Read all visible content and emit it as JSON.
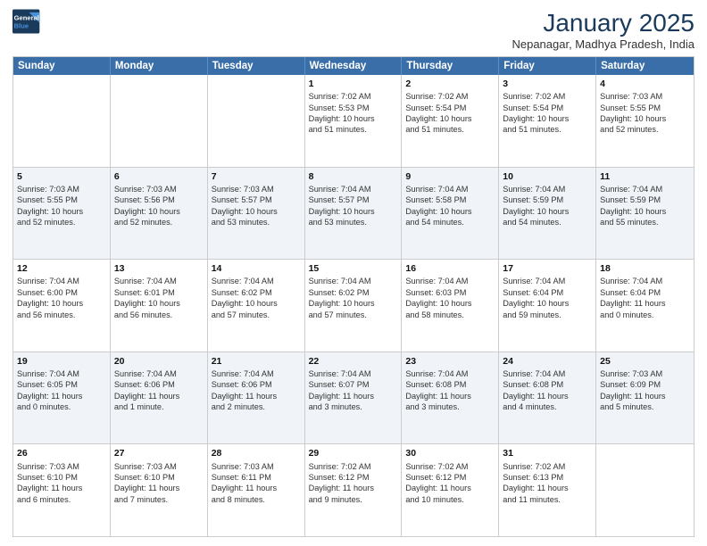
{
  "header": {
    "logo_line1": "General",
    "logo_line2": "Blue",
    "month": "January 2025",
    "location": "Nepanagar, Madhya Pradesh, India"
  },
  "days_of_week": [
    "Sunday",
    "Monday",
    "Tuesday",
    "Wednesday",
    "Thursday",
    "Friday",
    "Saturday"
  ],
  "rows": [
    [
      {
        "day": "",
        "info": ""
      },
      {
        "day": "",
        "info": ""
      },
      {
        "day": "",
        "info": ""
      },
      {
        "day": "1",
        "info": "Sunrise: 7:02 AM\nSunset: 5:53 PM\nDaylight: 10 hours\nand 51 minutes."
      },
      {
        "day": "2",
        "info": "Sunrise: 7:02 AM\nSunset: 5:54 PM\nDaylight: 10 hours\nand 51 minutes."
      },
      {
        "day": "3",
        "info": "Sunrise: 7:02 AM\nSunset: 5:54 PM\nDaylight: 10 hours\nand 51 minutes."
      },
      {
        "day": "4",
        "info": "Sunrise: 7:03 AM\nSunset: 5:55 PM\nDaylight: 10 hours\nand 52 minutes."
      }
    ],
    [
      {
        "day": "5",
        "info": "Sunrise: 7:03 AM\nSunset: 5:55 PM\nDaylight: 10 hours\nand 52 minutes."
      },
      {
        "day": "6",
        "info": "Sunrise: 7:03 AM\nSunset: 5:56 PM\nDaylight: 10 hours\nand 52 minutes."
      },
      {
        "day": "7",
        "info": "Sunrise: 7:03 AM\nSunset: 5:57 PM\nDaylight: 10 hours\nand 53 minutes."
      },
      {
        "day": "8",
        "info": "Sunrise: 7:04 AM\nSunset: 5:57 PM\nDaylight: 10 hours\nand 53 minutes."
      },
      {
        "day": "9",
        "info": "Sunrise: 7:04 AM\nSunset: 5:58 PM\nDaylight: 10 hours\nand 54 minutes."
      },
      {
        "day": "10",
        "info": "Sunrise: 7:04 AM\nSunset: 5:59 PM\nDaylight: 10 hours\nand 54 minutes."
      },
      {
        "day": "11",
        "info": "Sunrise: 7:04 AM\nSunset: 5:59 PM\nDaylight: 10 hours\nand 55 minutes."
      }
    ],
    [
      {
        "day": "12",
        "info": "Sunrise: 7:04 AM\nSunset: 6:00 PM\nDaylight: 10 hours\nand 56 minutes."
      },
      {
        "day": "13",
        "info": "Sunrise: 7:04 AM\nSunset: 6:01 PM\nDaylight: 10 hours\nand 56 minutes."
      },
      {
        "day": "14",
        "info": "Sunrise: 7:04 AM\nSunset: 6:02 PM\nDaylight: 10 hours\nand 57 minutes."
      },
      {
        "day": "15",
        "info": "Sunrise: 7:04 AM\nSunset: 6:02 PM\nDaylight: 10 hours\nand 57 minutes."
      },
      {
        "day": "16",
        "info": "Sunrise: 7:04 AM\nSunset: 6:03 PM\nDaylight: 10 hours\nand 58 minutes."
      },
      {
        "day": "17",
        "info": "Sunrise: 7:04 AM\nSunset: 6:04 PM\nDaylight: 10 hours\nand 59 minutes."
      },
      {
        "day": "18",
        "info": "Sunrise: 7:04 AM\nSunset: 6:04 PM\nDaylight: 11 hours\nand 0 minutes."
      }
    ],
    [
      {
        "day": "19",
        "info": "Sunrise: 7:04 AM\nSunset: 6:05 PM\nDaylight: 11 hours\nand 0 minutes."
      },
      {
        "day": "20",
        "info": "Sunrise: 7:04 AM\nSunset: 6:06 PM\nDaylight: 11 hours\nand 1 minute."
      },
      {
        "day": "21",
        "info": "Sunrise: 7:04 AM\nSunset: 6:06 PM\nDaylight: 11 hours\nand 2 minutes."
      },
      {
        "day": "22",
        "info": "Sunrise: 7:04 AM\nSunset: 6:07 PM\nDaylight: 11 hours\nand 3 minutes."
      },
      {
        "day": "23",
        "info": "Sunrise: 7:04 AM\nSunset: 6:08 PM\nDaylight: 11 hours\nand 3 minutes."
      },
      {
        "day": "24",
        "info": "Sunrise: 7:04 AM\nSunset: 6:08 PM\nDaylight: 11 hours\nand 4 minutes."
      },
      {
        "day": "25",
        "info": "Sunrise: 7:03 AM\nSunset: 6:09 PM\nDaylight: 11 hours\nand 5 minutes."
      }
    ],
    [
      {
        "day": "26",
        "info": "Sunrise: 7:03 AM\nSunset: 6:10 PM\nDaylight: 11 hours\nand 6 minutes."
      },
      {
        "day": "27",
        "info": "Sunrise: 7:03 AM\nSunset: 6:10 PM\nDaylight: 11 hours\nand 7 minutes."
      },
      {
        "day": "28",
        "info": "Sunrise: 7:03 AM\nSunset: 6:11 PM\nDaylight: 11 hours\nand 8 minutes."
      },
      {
        "day": "29",
        "info": "Sunrise: 7:02 AM\nSunset: 6:12 PM\nDaylight: 11 hours\nand 9 minutes."
      },
      {
        "day": "30",
        "info": "Sunrise: 7:02 AM\nSunset: 6:12 PM\nDaylight: 11 hours\nand 10 minutes."
      },
      {
        "day": "31",
        "info": "Sunrise: 7:02 AM\nSunset: 6:13 PM\nDaylight: 11 hours\nand 11 minutes."
      },
      {
        "day": "",
        "info": ""
      }
    ]
  ]
}
